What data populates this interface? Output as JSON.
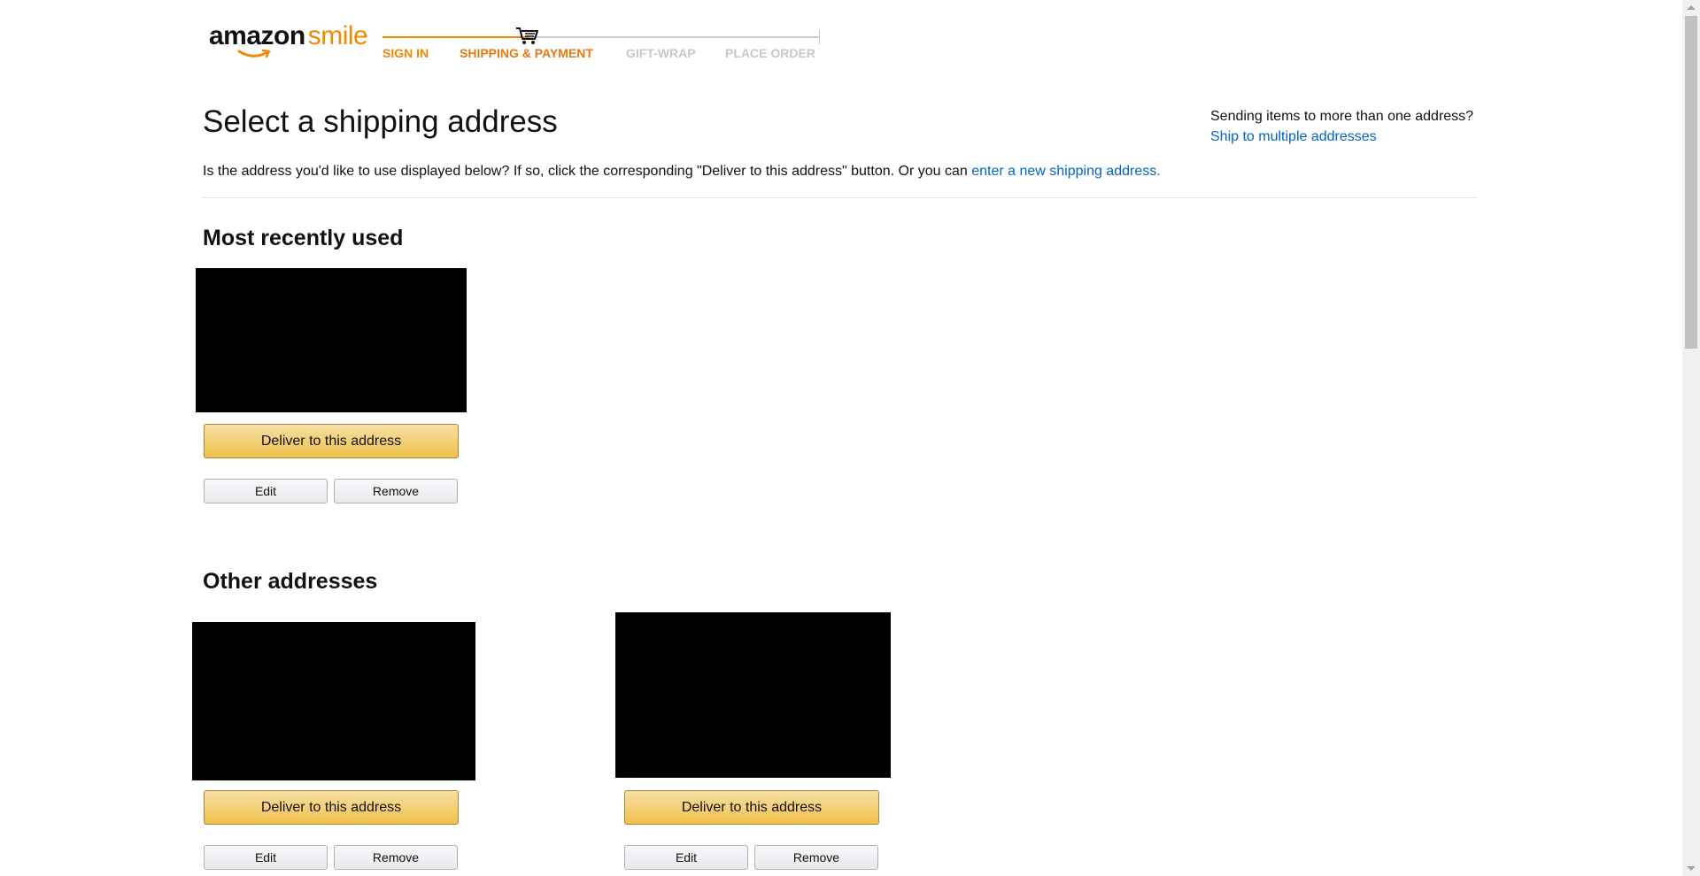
{
  "logo": {
    "part1": "amazon",
    "part2": "smile"
  },
  "progress": {
    "steps": [
      {
        "label": "SIGN IN",
        "state": "done"
      },
      {
        "label": "SHIPPING & PAYMENT",
        "state": "active"
      },
      {
        "label": "GIFT-WRAP",
        "state": "todo"
      },
      {
        "label": "PLACE ORDER",
        "state": "todo"
      }
    ]
  },
  "page": {
    "title": "Select a shipping address",
    "intro_text": "Is the address you'd like to use displayed below? If so, click the corresponding \"Deliver to this address\" button. Or you can ",
    "intro_link": "enter a new shipping address.",
    "multi_question": "Sending items to more than one address?",
    "multi_link": "Ship to multiple addresses"
  },
  "sections": {
    "recent_title": "Most recently used",
    "other_title": "Other addresses"
  },
  "address_actions": {
    "deliver_label": "Deliver to this address",
    "edit_label": "Edit",
    "remove_label": "Remove"
  },
  "colors": {
    "accent_orange": "#f08804",
    "link_blue": "#0066c0",
    "primary_button": "#f0c14b"
  }
}
